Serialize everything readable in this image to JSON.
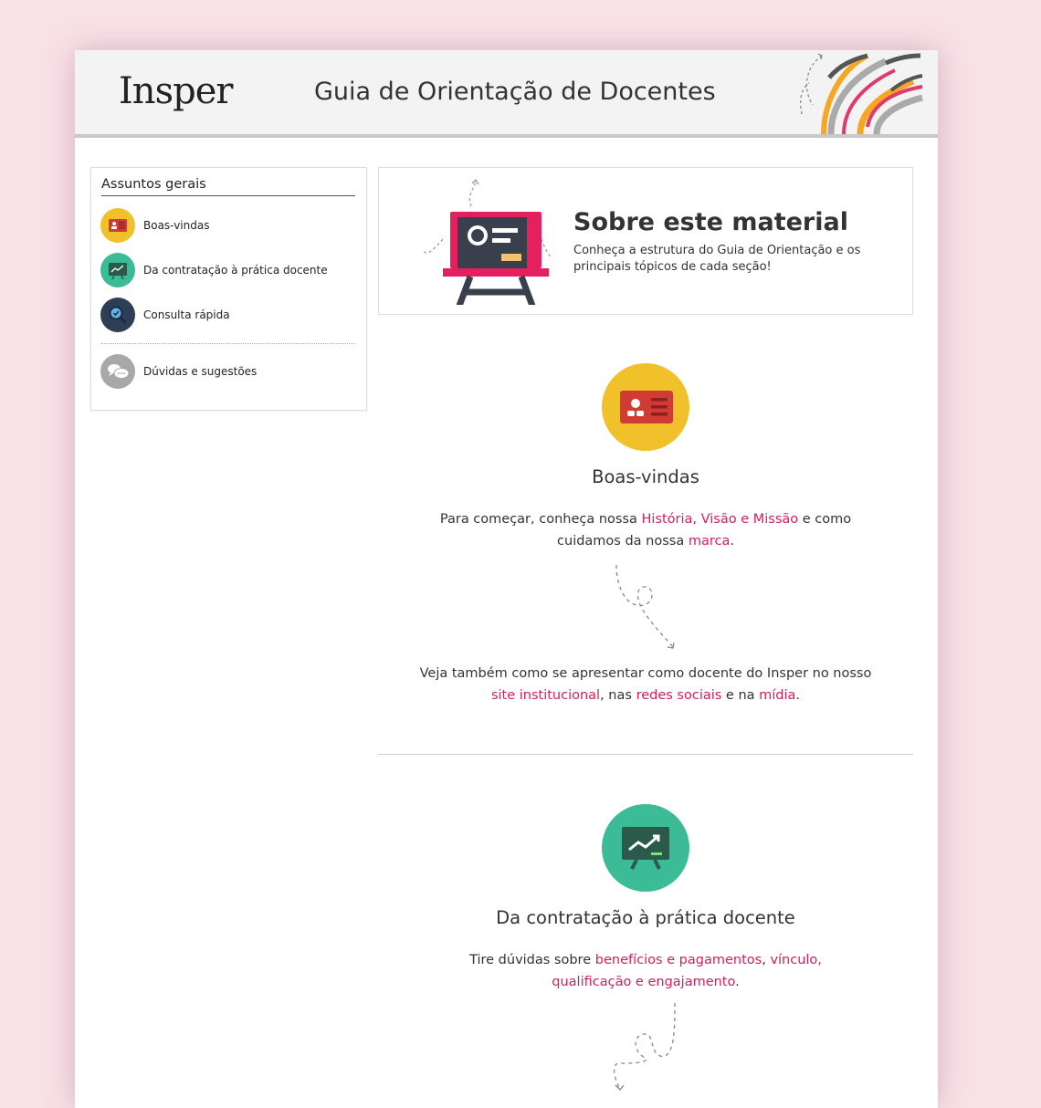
{
  "header": {
    "logo_text": "Insper",
    "title": "Guia de Orientação de Docentes"
  },
  "sidebar": {
    "title": "Assuntos gerais",
    "items": [
      {
        "label": "Boas-vindas",
        "icon": "id-card-icon",
        "color": "#f0c12b"
      },
      {
        "label": "Da contratação à prática docente",
        "icon": "presentation-board-icon",
        "color": "#3bbb96"
      },
      {
        "label": "Consulta rápida",
        "icon": "magnifier-icon",
        "color": "#2e3e56"
      },
      {
        "label": "Dúvidas e sugestões",
        "icon": "chat-bubbles-icon",
        "color": "#a8a8a8"
      }
    ]
  },
  "about": {
    "title": "Sobre este material",
    "text": "Conheça a estrutura do Guia de Orientação e os principais tópicos de cada seção!"
  },
  "sections": {
    "boas_vindas": {
      "title": "Boas-vindas",
      "p1_a": "Para começar, conheça nossa ",
      "p1_link1": "História, Visão e Missão",
      "p1_b": " e como cuidamos da nossa ",
      "p1_link2": "marca",
      "p1_c": ".",
      "p2_a": "Veja também como se apresentar como docente do Insper no nosso ",
      "p2_link1": "site institucional",
      "p2_b": ", nas ",
      "p2_link2": "redes sociais",
      "p2_c": " e na ",
      "p2_link3": "mídia",
      "p2_d": "."
    },
    "contratacao": {
      "title": "Da contratação à prática docente",
      "p1_a": "Tire dúvidas sobre ",
      "p1_link1": "benefícios e pagamentos",
      "p1_b": ", ",
      "p1_link2": "vínculo,",
      "p1_c": " ",
      "p1_link3": "qualificação e engajamento",
      "p1_d": "."
    }
  },
  "colors": {
    "accent_link": "#d91c5c",
    "background": "#f9e1e8",
    "yellow": "#f0c12b",
    "green": "#3bbb96",
    "navy": "#2e3e56",
    "red": "#e03a3e"
  }
}
